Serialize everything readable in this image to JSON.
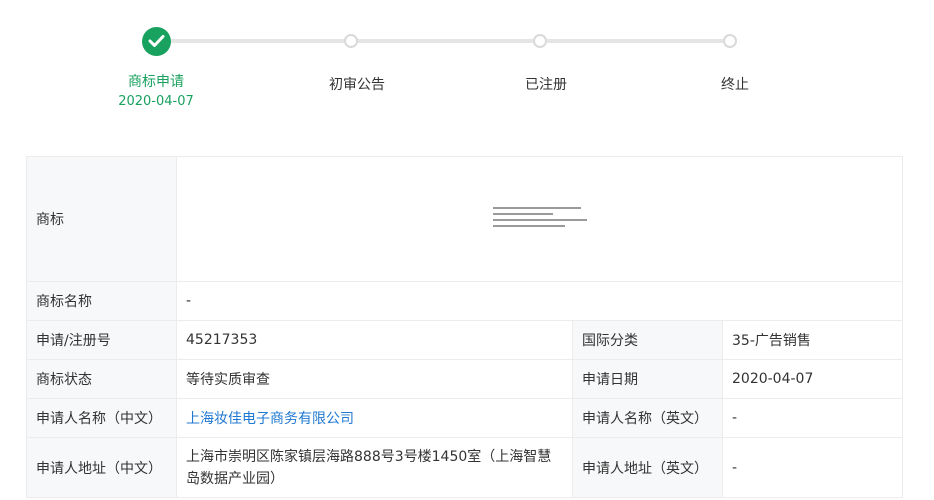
{
  "steps": [
    {
      "label": "商标申请",
      "date": "2020-04-07",
      "status": "done"
    },
    {
      "label": "初审公告",
      "status": "pending"
    },
    {
      "label": "已注册",
      "status": "pending"
    },
    {
      "label": "终止",
      "status": "pending"
    }
  ],
  "colors": {
    "accent": "#19a15f",
    "link": "#1f78d1",
    "label_bg": "#f7f8fa",
    "border": "#ececec"
  },
  "info": {
    "trademark_label": "商标",
    "name_label": "商标名称",
    "name_value": "-",
    "reg_no_label": "申请/注册号",
    "reg_no_value": "45217353",
    "intl_class_label": "国际分类",
    "intl_class_value": "35-广告销售",
    "status_label": "商标状态",
    "status_value": "等待实质审查",
    "apply_date_label": "申请日期",
    "apply_date_value": "2020-04-07",
    "applicant_cn_label": "申请人名称（中文）",
    "applicant_cn_value": "上海妆佳电子商务有限公司",
    "applicant_en_label": "申请人名称（英文）",
    "applicant_en_value": "-",
    "address_cn_label": "申请人地址（中文）",
    "address_cn_value": "上海市崇明区陈家镇层海路888号3号楼1450室（上海智慧岛数据产业园）",
    "address_en_label": "申请人地址（英文）",
    "address_en_value": "-"
  }
}
